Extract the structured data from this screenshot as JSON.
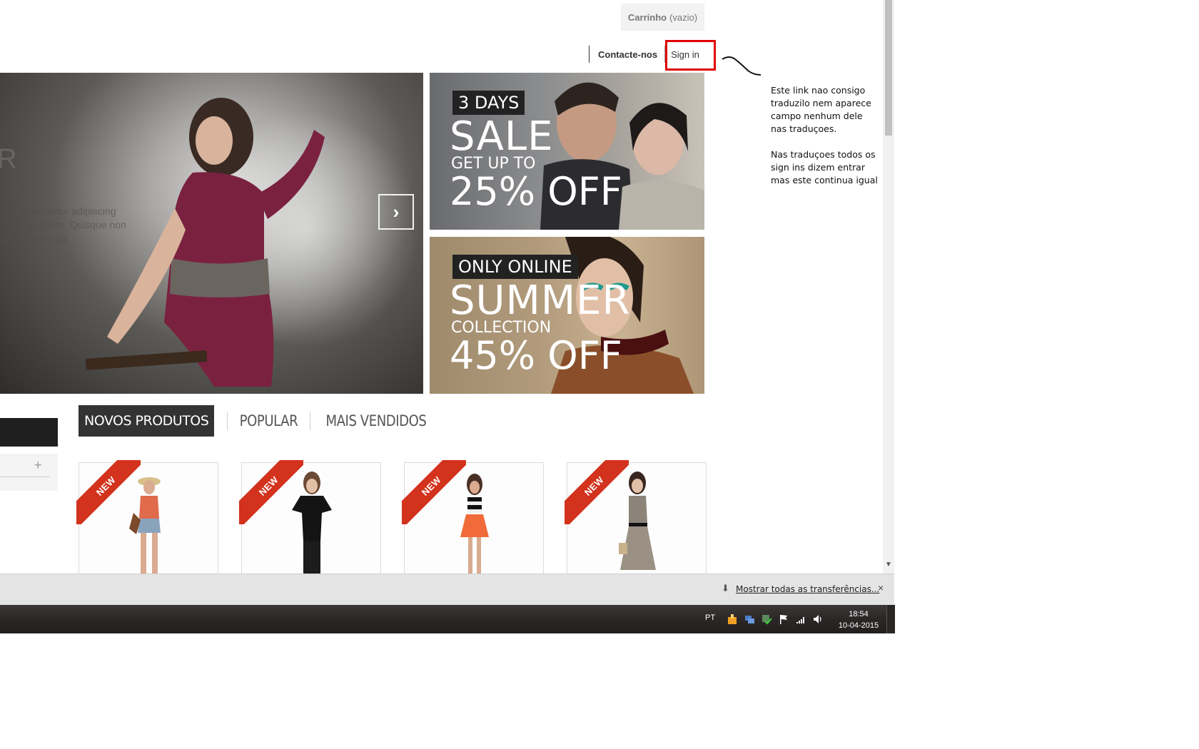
{
  "header": {
    "cart_label": "Carrinho",
    "cart_status": "(vazio)",
    "contact_label": "Contacte-nos",
    "signin_label": "Sign in"
  },
  "hero": {
    "title_fragment": "R",
    "text_line_1": "consectetur adipiscing",
    "text_line_2": "trices dignissim. Quisque non",
    "text_line_3": "egestas sem elit",
    "next_arrow": "›"
  },
  "banners": [
    {
      "tag": "3 DAYS",
      "big": "SALE",
      "mid": "GET UP TO",
      "off": "25% OFF"
    },
    {
      "tag": "ONLY ONLINE",
      "big": "SUMMER",
      "mid": "COLLECTION",
      "off": "45% OFF"
    }
  ],
  "sidebar": {
    "plus": "+"
  },
  "tabs": [
    {
      "label": "NOVOS PRODUTOS",
      "active": true
    },
    {
      "label": "POPULAR",
      "active": false
    },
    {
      "label": "MAIS VENDIDOS",
      "active": false
    }
  ],
  "products": [
    {
      "badge": "NEW",
      "icon": "woman-in-red-top-and-shorts"
    },
    {
      "badge": "NEW",
      "icon": "woman-in-black-outfit"
    },
    {
      "badge": "NEW",
      "icon": "woman-in-striped-top-and-orange-skirt"
    },
    {
      "badge": "NEW",
      "icon": "woman-in-printed-dress"
    }
  ],
  "download_bar": {
    "link": "Mostrar todas as  transferências...",
    "close": "×"
  },
  "taskbar": {
    "language": "PT",
    "time": "18:54",
    "date": "10-04-2015"
  },
  "annotation": {
    "note": "Este link nao consigo traduzilo nem aparece campo nenhum dele nas traduçoes.\n\nNas traduçoes todos os sign ins dizem entrar mas este continua igual"
  },
  "colors": {
    "highlight_box": "#e00000",
    "ribbon": "#d3321d",
    "active_tab": "#333333"
  }
}
